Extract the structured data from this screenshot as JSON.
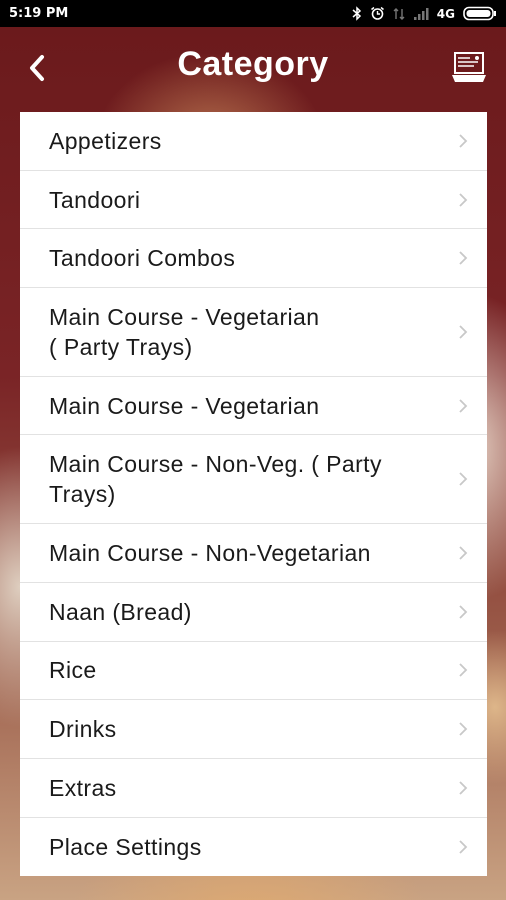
{
  "status_bar": {
    "time": "5:19 PM",
    "network": "4G",
    "icons": [
      "bluetooth-icon",
      "alarm-icon",
      "data-arrows-icon",
      "signal-icon",
      "battery-icon"
    ]
  },
  "header": {
    "title": "Category",
    "back_icon": "chevron-left-icon",
    "menu_icon": "menu-board-icon",
    "text_color": "#ffffff"
  },
  "categories": [
    {
      "label": "Appetizers"
    },
    {
      "label": "Tandoori"
    },
    {
      "label": "Tandoori Combos"
    },
    {
      "label": "Main Course - Vegetarian\n( Party Trays)"
    },
    {
      "label": "Main Course - Vegetarian"
    },
    {
      "label": "Main Course - Non-Veg. ( Party\nTrays)"
    },
    {
      "label": "Main Course - Non-Vegetarian"
    },
    {
      "label": "Naan (Bread)"
    },
    {
      "label": "Rice"
    },
    {
      "label": "Drinks"
    },
    {
      "label": "Extras"
    },
    {
      "label": "Place Settings"
    }
  ],
  "colors": {
    "background": "#6b1a1c",
    "list_background": "#ffffff",
    "text": "#1a1a1a",
    "chevron": "#c8c8c8"
  }
}
